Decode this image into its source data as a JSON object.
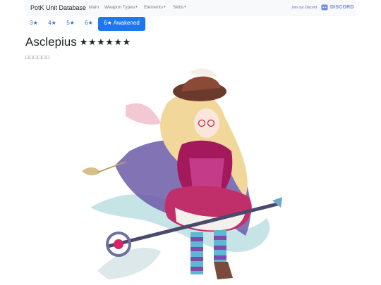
{
  "navbar": {
    "brand": "PotK Unit Database",
    "links": [
      {
        "label": "Main"
      },
      {
        "label": "Weapon Types"
      },
      {
        "label": "Elements"
      },
      {
        "label": "Skills"
      }
    ],
    "join_text": "Join our Discord",
    "discord_word": "DISCORD"
  },
  "tabs": [
    {
      "label": "3★",
      "active": false
    },
    {
      "label": "4★",
      "active": false
    },
    {
      "label": "5★",
      "active": false
    },
    {
      "label": "6★",
      "active": false
    },
    {
      "label": "6★ Awakened",
      "active": true
    }
  ],
  "unit": {
    "name": "Asclepius",
    "stars": "★★★★★★",
    "japanese_name": "□□□□□□"
  },
  "colors": {
    "accent": "#1e77f0",
    "link": "#2f6fd6",
    "navbar_bg": "#f8f9fa",
    "discord": "#7289da"
  }
}
